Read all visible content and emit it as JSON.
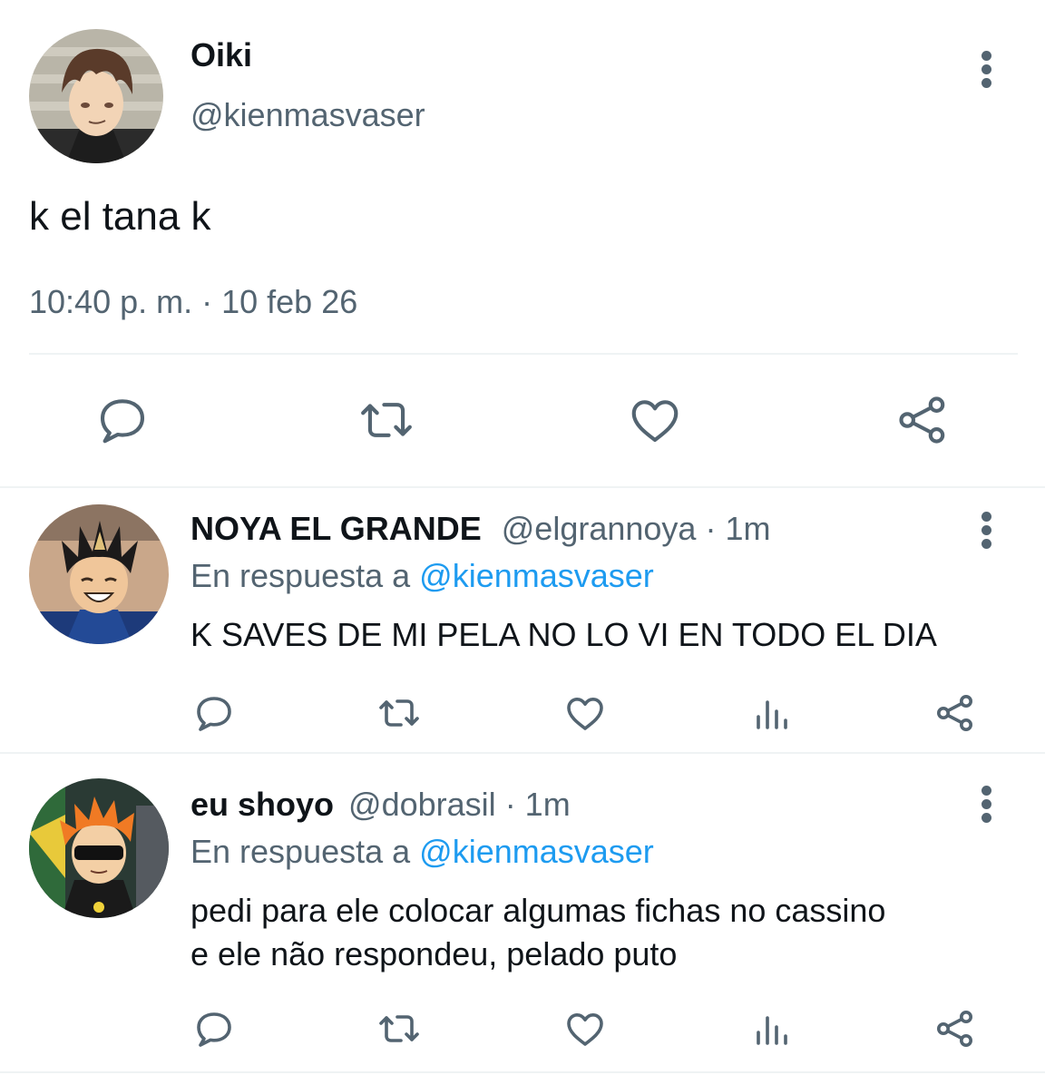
{
  "main_tweet": {
    "author_name": "Oiki",
    "author_handle": "@kienmasvaser",
    "text": "k el tana k",
    "timestamp": "10:40 p. m. · 10 feb 26",
    "actions": [
      "reply-icon",
      "retweet-icon",
      "like-icon",
      "share-icon"
    ]
  },
  "replies": [
    {
      "author_name": "NOYA EL GRANDE",
      "author_handle": "@elgrannoya",
      "time": "· 1m",
      "reply_prefix": "En respuesta a",
      "reply_to": "@kienmasvaser",
      "text_lines": [
        "K SAVES DE MI PELA NO LO VI EN TODO EL DIA"
      ],
      "actions": [
        "reply-icon",
        "retweet-icon",
        "like-icon",
        "views-icon",
        "share-icon"
      ]
    },
    {
      "author_name": "eu shoyo",
      "author_handle": "@dobrasil",
      "time": "· 1m",
      "reply_prefix": "En respuesta a",
      "reply_to": "@kienmasvaser",
      "text_lines": [
        "pedi para ele colocar algumas fichas no cassino",
        "e ele não respondeu, pelado puto"
      ],
      "actions": [
        "reply-icon",
        "retweet-icon",
        "like-icon",
        "views-icon",
        "share-icon"
      ]
    }
  ],
  "colors": {
    "text": "#0f1419",
    "muted": "#536471",
    "link": "#1d9bf0",
    "divider": "#eff3f4"
  }
}
